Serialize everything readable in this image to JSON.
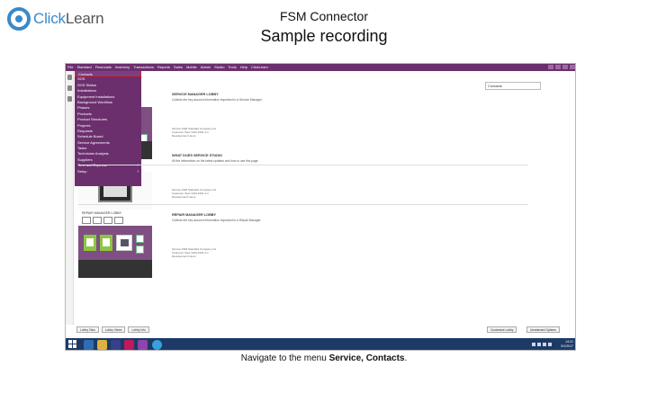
{
  "slide": {
    "title": "FSM Connector",
    "subtitle": "Sample recording",
    "logo": {
      "part1": "Click",
      "part2": "Learn"
    },
    "caption_before": "Navigate to the menu ",
    "caption_bold": "Service, Contacts",
    "caption_after": "."
  },
  "app": {
    "accent": "#6b2f6e",
    "menubar": [
      "File",
      "Standard",
      "Financials",
      "Inventory",
      "Transactions",
      "Reports",
      "Sales",
      "Mobile",
      "Admin",
      "Studio",
      "Tools",
      "Help",
      "ClickLearn"
    ],
    "search": {
      "value": "Contacts"
    },
    "dropdown": [
      {
        "label": "Contacts",
        "selected": true,
        "arrow": false
      },
      {
        "label": "SOS",
        "selected": false,
        "arrow": false
      },
      {
        "label": "SOS Status",
        "selected": false,
        "arrow": false
      },
      {
        "label": "Installations",
        "selected": false,
        "arrow": false
      },
      {
        "label": "Equipment Installations",
        "selected": false,
        "arrow": false
      },
      {
        "label": "Background Workflow",
        "selected": false,
        "arrow": false
      },
      {
        "label": "Phases",
        "selected": false,
        "arrow": false
      },
      {
        "label": "Products",
        "selected": false,
        "arrow": false
      },
      {
        "label": "Product Structures",
        "selected": false,
        "arrow": false
      },
      {
        "label": "Projects",
        "selected": false,
        "arrow": false
      },
      {
        "label": "Requests",
        "selected": false,
        "arrow": false
      },
      {
        "label": "Schedule Board",
        "selected": false,
        "arrow": false
      },
      {
        "label": "Service Agreements",
        "selected": false,
        "arrow": false
      },
      {
        "label": "Tasks",
        "selected": false,
        "arrow": false
      },
      {
        "label": "Technician Analysis",
        "selected": false,
        "arrow": false
      },
      {
        "label": "Suppliers",
        "selected": false,
        "arrow": false
      },
      {
        "label": "Time and Expense",
        "selected": false,
        "arrow": true
      },
      {
        "label": "Setup",
        "selected": false,
        "arrow": true
      }
    ],
    "boxes": [
      {
        "title": "SERVICE MANAGER LOBBY",
        "desc": "Collects the key account information important to a Service Manager.",
        "meta": "Service FSM Standard Company Ltd.\nCustomer View 1234-1001-1-1\nDevelopment Users"
      },
      {
        "title": "WHAT DOES SERVICE STUDIO",
        "desc": "All the information on the latest updates and how to use this page.",
        "meta": "Service FSM Standard Company Ltd.\nCustomer View 1234-1001-1-1\nDevelopment Users"
      },
      {
        "title": "REPAIR MANAGER LOBBY",
        "desc": "Collects the key account information important to a Repair Manager.",
        "meta": "Service FSM Standard Company Ltd.\nCustomer View 1234-1001-1-1\nDevelopment Users"
      }
    ],
    "tile_header": "REPAIR MANAGER LOBBY",
    "bottom_buttons": [
      "Lobby Tabs",
      "Lobby Views",
      "Lobby Info"
    ],
    "bottom_right_buttons": [
      "Customize Lobby",
      "Unselected Options"
    ],
    "tray": {
      "time": "14:21",
      "date": "5/1/2017"
    }
  }
}
